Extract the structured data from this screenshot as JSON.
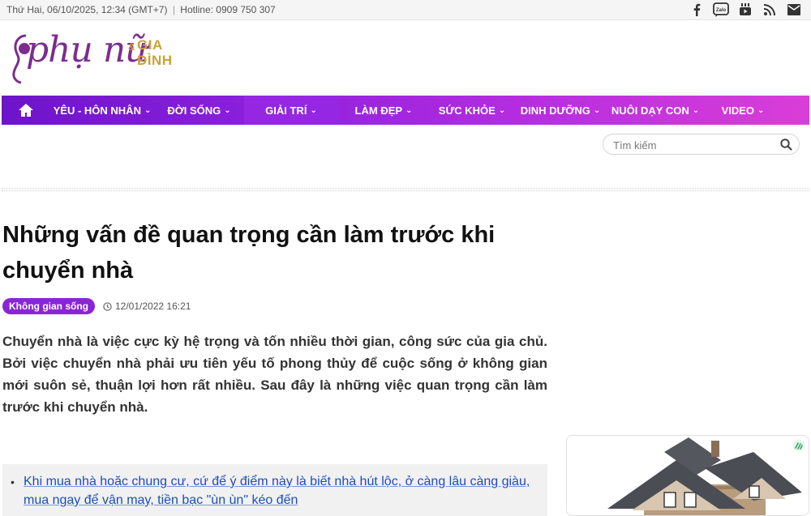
{
  "topbar": {
    "date": "Thứ Hai, 06/10/2025, 12:34 (GMT+7)",
    "separator": "|",
    "hotline": "Hotline: 0909 750 307"
  },
  "social": [
    {
      "name": "facebook-icon"
    },
    {
      "name": "zalo-icon"
    },
    {
      "name": "youtube-icon"
    },
    {
      "name": "rss-icon"
    },
    {
      "name": "email-icon"
    }
  ],
  "logo": {
    "script": "phụ nữ",
    "amp": "&",
    "gia": "GIA",
    "dinh": "ĐÌNH"
  },
  "nav": {
    "items": [
      {
        "label": "YÊU - HÔN NHÂN",
        "width": 128
      },
      {
        "label": "ĐỜI SỐNG",
        "width": 111
      },
      {
        "label": "GIẢI TRÍ",
        "width": 116
      },
      {
        "label": "LÀM ĐẸP",
        "width": 112
      },
      {
        "label": "SỨC KHỎE",
        "width": 106
      },
      {
        "label": "DINH DƯỠNG",
        "width": 112
      },
      {
        "label": "NUÔI DẠY CON",
        "width": 122
      },
      {
        "label": "VIDEO",
        "width": 94
      }
    ],
    "chevron": "⌄"
  },
  "search": {
    "placeholder": "Tìm kiếm"
  },
  "article": {
    "title": "Những vấn đề quan trọng cần làm trước khi chuyển nhà",
    "category": "Không gian sống",
    "datetime": "12/01/2022 16:21",
    "lead": "Chuyển nhà là việc cực kỳ hệ trọng và tốn nhiều thời gian, công sức của gia chủ. Bởi việc chuyển nhà phải ưu tiên yếu tố phong thủy để cuộc sống ở không gian mới suôn sẻ, thuận lợi hơn rất nhiều. Sau đây là những việc quan trọng cần làm trước khi chuyển nhà.",
    "related_bullet": "•",
    "related_link": "Khi mua nhà hoặc chung cư, cứ để ý điểm này là biết nhà hút lộc, ở càng lâu càng giàu, mua ngay để vận may, tiền bạc \"ùn ùn\" kéo đến"
  },
  "colors": {
    "nav_start": "#6d14c9",
    "nav_end": "#d93ed8",
    "badge": "#8a24d6",
    "link": "#1a4fbf",
    "logo_purple": "#7b2d8f",
    "logo_gold": "#c9a33a"
  }
}
